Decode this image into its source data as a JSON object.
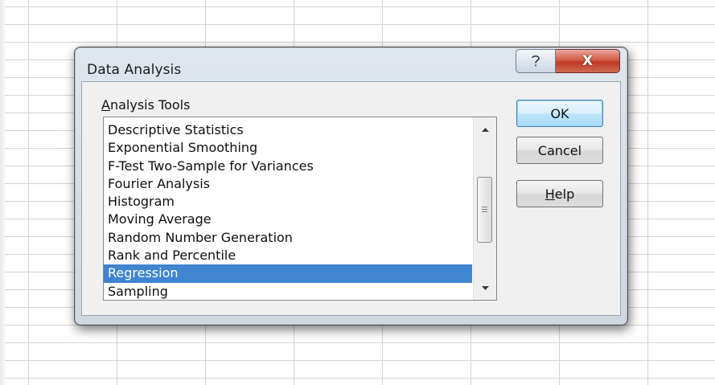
{
  "dialog": {
    "title": "Data Analysis",
    "help_glyph": "?",
    "close_glyph": "X"
  },
  "analysis_tools": {
    "label_accel": "A",
    "label_rest": "nalysis Tools",
    "items": [
      "Descriptive Statistics",
      "Exponential Smoothing",
      "F-Test Two-Sample for Variances",
      "Fourier Analysis",
      "Histogram",
      "Moving Average",
      "Random Number Generation",
      "Rank and Percentile",
      "Regression",
      "Sampling"
    ],
    "selected": "Regression"
  },
  "buttons": {
    "ok": "OK",
    "cancel": "Cancel",
    "help_accel": "H",
    "help_rest": "elp"
  },
  "icons": {
    "help": "question-mark-icon",
    "close": "close-icon",
    "scroll_up": "chevron-up-icon",
    "scroll_down": "chevron-down-icon",
    "scroll_grip": "grip-icon"
  },
  "colors": {
    "selection": "#3f85d0",
    "close_button": "#c9462f",
    "ok_border": "#3c7fb1"
  }
}
